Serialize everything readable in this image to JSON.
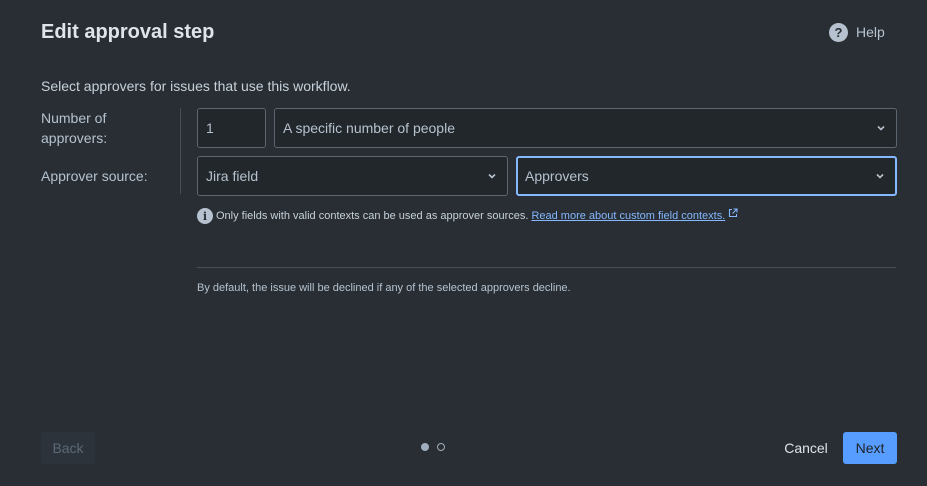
{
  "dialog": {
    "title": "Edit approval step",
    "help_label": "Help",
    "intro": "Select approvers for issues that use this workflow."
  },
  "form": {
    "number_label_line1": "Number of",
    "number_label_line2": "approvers:",
    "number_value": "1",
    "number_mode": "A specific number of people",
    "source_label": "Approver source:",
    "source_type": "Jira field",
    "source_field": "Approvers"
  },
  "info": {
    "text": "Only fields with valid contexts can be used as approver sources.",
    "link_text": "Read more about custom field contexts."
  },
  "note": "By default, the issue will be declined if any of the selected approvers decline.",
  "footer": {
    "back_label": "Back",
    "cancel_label": "Cancel",
    "next_label": "Next",
    "pager": {
      "current": 1,
      "total": 2
    }
  },
  "colors": {
    "background": "#282e33",
    "primary": "#579dff",
    "link": "#85b8ff",
    "focus_border": "#85b8ff"
  },
  "icons": [
    "help-icon",
    "chevron-down-icon",
    "info-icon",
    "external-link-icon"
  ]
}
